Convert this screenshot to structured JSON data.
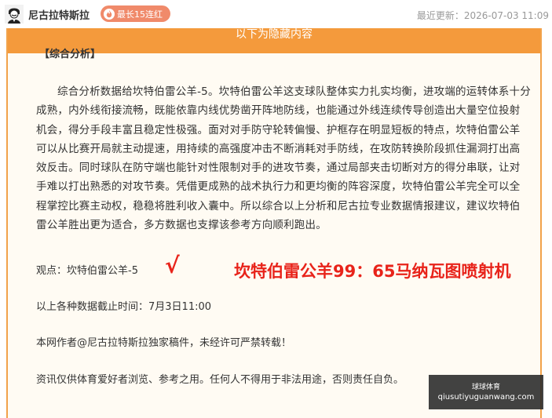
{
  "header": {
    "author": "尼古拉特斯拉",
    "badge": "最长15连红",
    "updated": "最近更新：2026-07-03 11:09"
  },
  "banner": {
    "text": "以下为隐藏内容"
  },
  "article": {
    "section_title": "【综合分析】",
    "body": "综合分析数据给坎特伯雷公羊-5。坎特伯雷公羊这支球队整体实力扎实均衡，进攻端的运转体系十分成熟，内外线衔接流畅，既能依靠内线优势凿开阵地防线，也能通过外线连续传导创造出大量空位投射机会，得分手段丰富且稳定性极强。面对对手防守轮转偏慢、护框存在明显短板的特点，坎特伯雷公羊可以从比赛开局就主动提速，用持续的高强度冲击不断消耗对手防线，在攻防转换阶段抓住漏洞打出高效反击。同时球队在防守端也能针对性限制对手的进攻节奏，通过局部夹击切断对方的得分串联，让对手难以打出熟悉的对攻节奏。凭借更成熟的战术执行力和更均衡的阵容深度，坎特伯雷公羊完全可以全程掌控比赛主动权，稳稳将胜利收入囊中。所以综合以上分析和尼古拉专业数据情报建议，建议坎特伯雷公羊胜出更为适合，多方数据也支撑该参考方向顺利跑出。",
    "viewpoint": "观点：坎特伯雷公羊-5",
    "check": "√",
    "promo": "坎特伯雷公羊99：65马纳瓦图喷射机",
    "deadline": "以上各种数据截止时间：7月3日11:00",
    "copyright": "本网作者@尼古拉特斯拉独家稿件，未经许可严禁转载！",
    "disclaimer": "资讯仅供体育爱好者浏览、参考之用。任何人不得用于非法用途，否则责任自负。"
  },
  "watermark": {
    "top": "球球体育",
    "bottom": "qiusutiyuguanwang.com"
  },
  "colors": {
    "accent": "#f49a3c",
    "badge": "#f08a6a",
    "highlight": "#e8231a"
  }
}
